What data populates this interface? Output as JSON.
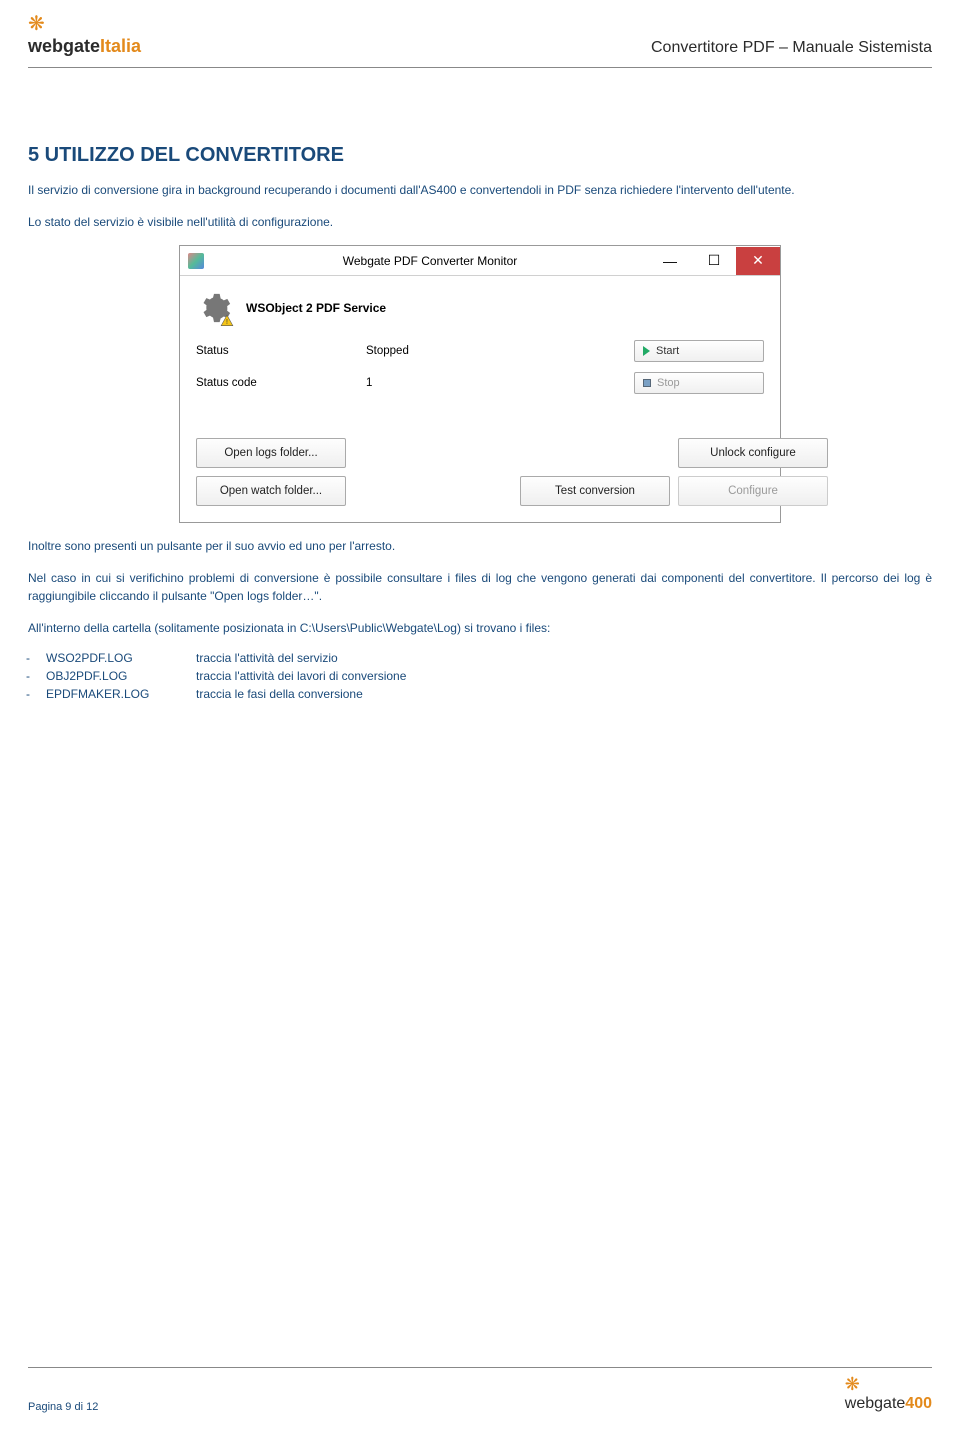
{
  "header": {
    "logo_text_a": "webgate",
    "logo_text_b": "Italia",
    "doc_title": "Convertitore PDF – Manuale Sistemista"
  },
  "section": {
    "heading": "5  UTILIZZO DEL CONVERTITORE",
    "p1": "Il servizio di conversione gira in background recuperando i documenti dall'AS400 e convertendoli in PDF senza richiedere l'intervento dell'utente.",
    "p2": "Lo stato del servizio è visibile nell'utilità di configurazione."
  },
  "window": {
    "title": "Webgate PDF Converter Monitor",
    "service_name": "WSObject 2 PDF Service",
    "status_label": "Status",
    "status_value": "Stopped",
    "status_code_label": "Status code",
    "status_code_value": "1",
    "start_label": "Start",
    "stop_label": "Stop",
    "open_logs": "Open logs folder...",
    "open_watch": "Open watch folder...",
    "unlock": "Unlock configure",
    "test": "Test conversion",
    "configure": "Configure"
  },
  "after": {
    "p3": "Inoltre sono presenti un pulsante per il suo avvio ed uno per l'arresto.",
    "p4": "Nel caso in cui si verifichino problemi di conversione è possibile consultare i files di log che vengono generati dai componenti del convertitore. Il percorso dei log è raggiungibile cliccando il pulsante \"Open logs folder…\".",
    "p5": "All'interno della cartella (solitamente posizionata in C:\\Users\\Public\\Webgate\\Log) si trovano i files:",
    "files": [
      {
        "name": "WSO2PDF.LOG",
        "desc": "traccia l'attività del servizio"
      },
      {
        "name": "OBJ2PDF.LOG",
        "desc": "traccia l'attività dei lavori di conversione"
      },
      {
        "name": "EPDFMAKER.LOG",
        "desc": "traccia le fasi della conversione"
      }
    ]
  },
  "footer": {
    "page": "Pagina 9 di 12",
    "logo_a": "webgate",
    "logo_b": "400"
  }
}
